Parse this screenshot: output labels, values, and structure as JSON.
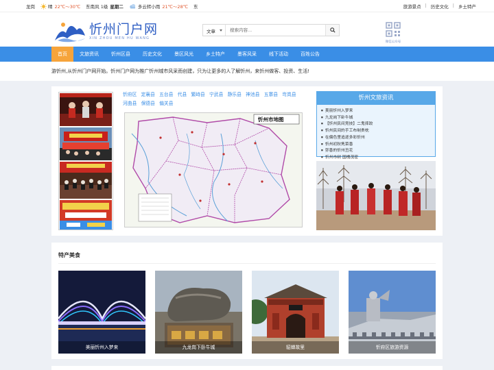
{
  "topbar": {
    "city": "龙岗",
    "today_weather": "晴",
    "today_temp": "22℃～30℃",
    "today_wind": "东南风 1级",
    "weekday": "星期二",
    "tomorrow_weather": "多云转小雨",
    "tomorrow_temp": "21℃～28℃",
    "tomorrow_wind": "东",
    "links": [
      "旅游景点",
      "历史文化",
      "乡土特产"
    ]
  },
  "header": {
    "logo_title": "忻州门户网",
    "logo_subtitle": "XIN ZHOU MEN HU WANG",
    "search_scope": "文章",
    "search_placeholder": "搜索内容...",
    "qr_label": "微信公众号"
  },
  "nav": {
    "items": [
      "首页",
      "文旅资讯",
      "忻州区县",
      "历史文化",
      "景区风光",
      "乡土特产",
      "墨客风采",
      "线下活动",
      "百姓公告"
    ],
    "active_index": 0
  },
  "notice": "游忻州,从忻州门户网开始。忻州门户网为推广忻州城市风采而创建，只为让更多的人了解忻州，来忻州做客、投资、生活!",
  "districts": [
    "忻府区",
    "定襄县",
    "五台县",
    "代县",
    "繁峙县",
    "宁武县",
    "静乐县",
    "神池县",
    "五寨县",
    "岢岚县",
    "河曲县",
    "保德县",
    "偏关县"
  ],
  "map": {
    "title": "忻州市地图"
  },
  "infobox": {
    "title": "忻州文旅资讯",
    "items": [
      "美丽忻州入梦来",
      "九龙岗下卧牛城",
      "【忻州民间竞技】二鬼摔跤",
      "忻州民间的手工布制贵枕",
      "在偏色里追逐多彩忻州",
      "忻州初秋隽菜香",
      "弥香的忻州丑花",
      "忻州市树 国槐茂密"
    ]
  },
  "specialties": {
    "title": "特产美食",
    "cards": [
      "美丽忻州入梦来",
      "九龙岗下卧牛城",
      "貂蝉故里",
      "忻府区旅游资源"
    ]
  }
}
